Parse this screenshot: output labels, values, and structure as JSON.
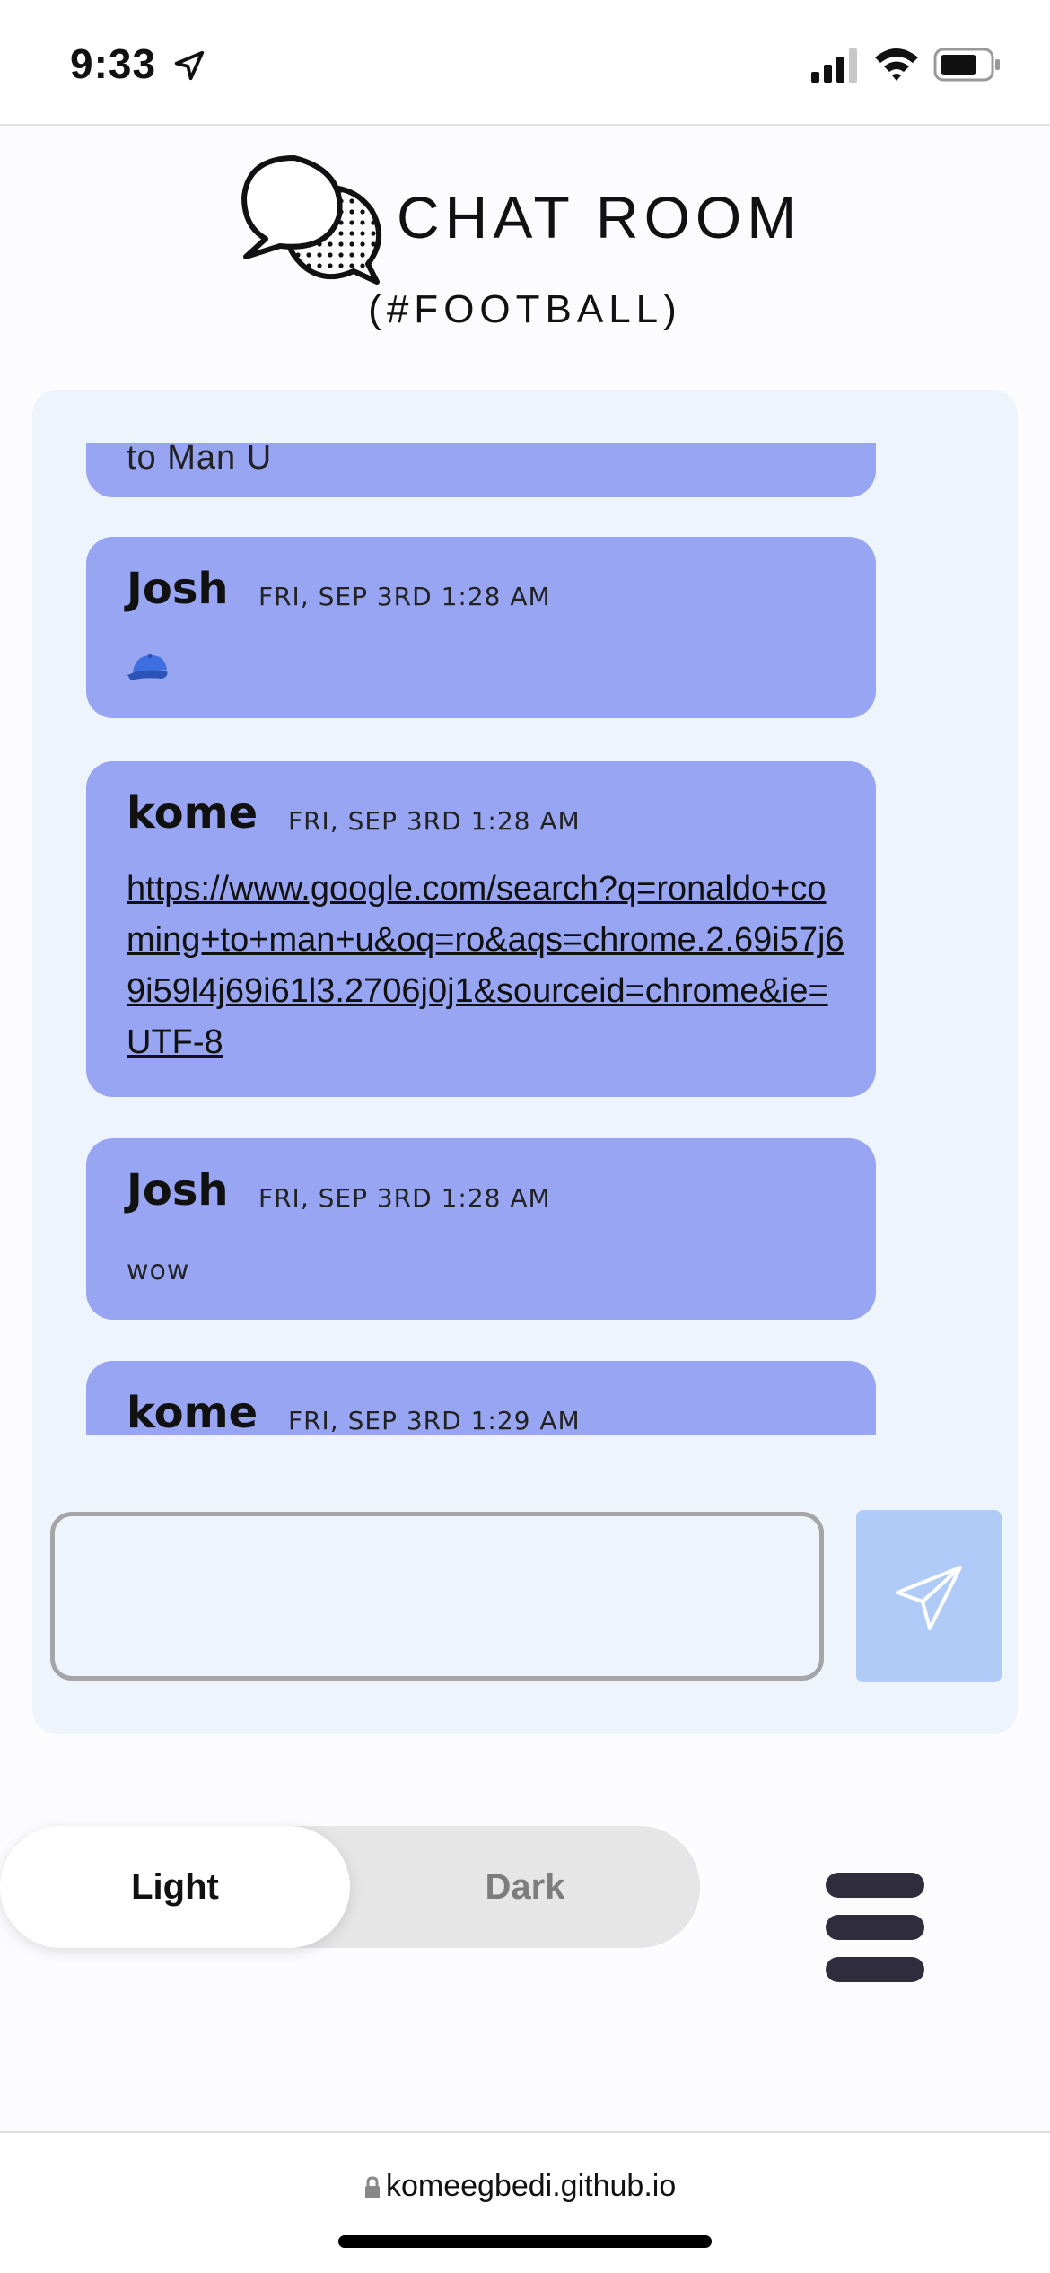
{
  "status_bar": {
    "time": "9:33",
    "icons": [
      "location-arrow-icon",
      "cellular-signal-icon",
      "wifi-icon",
      "battery-icon"
    ]
  },
  "header": {
    "title": "CHAT ROOM",
    "channel": "(#FOOTBALL)",
    "logo_icon": "speech-bubbles-icon"
  },
  "messages": [
    {
      "text": "to Man U"
    },
    {
      "author": "Josh",
      "time": "FRI, SEP 3RD 1:28 AM",
      "emoji_icon": "baseball-cap-icon"
    },
    {
      "author": "kome",
      "time": "FRI, SEP 3RD 1:28 AM",
      "link": "https://www.google.com/search?q=ronaldo+coming+to+man+u&oq=ro&aqs=chrome.2.69i57j69i59l4j69i61l3.2706j0j1&sourceid=chrome&ie=UTF-8"
    },
    {
      "author": "Josh",
      "time": "FRI, SEP 3RD 1:28 AM",
      "text": "wow"
    },
    {
      "author": "kome",
      "time": "FRI, SEP 3RD 1:29 AM"
    }
  ],
  "composer": {
    "input_value": "",
    "send_icon": "paper-plane-icon"
  },
  "theme_toggle": {
    "light_label": "Light",
    "dark_label": "Dark",
    "selected": "Light"
  },
  "menu_icon": "hamburger-menu-icon",
  "address_bar": {
    "url": "komeegbedi.github.io"
  },
  "colors": {
    "bubble": "#97a5f2",
    "panel": "#eef4fc",
    "send_button": "#b0cbf7",
    "menu": "#2f2c3e"
  }
}
